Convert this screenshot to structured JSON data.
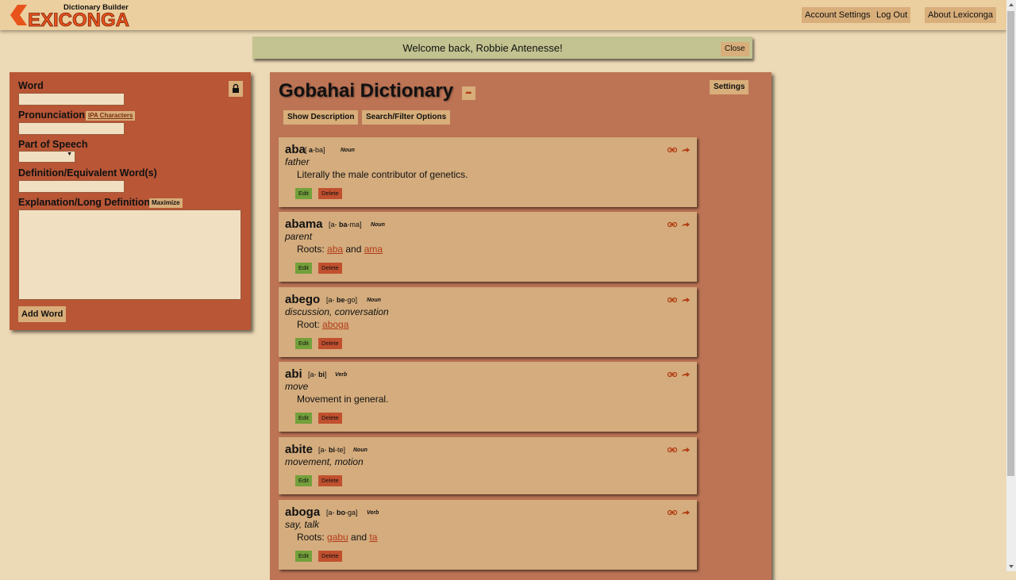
{
  "header": {
    "logo_tagline": "Dictionary Builder",
    "logo_text": "EXICONGA",
    "buttons": {
      "account_settings": "Account Settings",
      "log_out": "Log Out",
      "about": "About Lexiconga"
    }
  },
  "welcome": {
    "message": "Welcome back, Robbie Antenesse!",
    "close_label": "Close"
  },
  "word_form": {
    "word_label": "Word",
    "pronunciation_label": "Pronunciation",
    "ipa_label": "IPA Characters",
    "part_of_speech_label": "Part of Speech",
    "part_of_speech_value": "",
    "definition_label": "Definition/Equivalent Word(s)",
    "explanation_label": "Explanation/Long Definition",
    "maximize_label": "Maximize",
    "add_word_label": "Add Word"
  },
  "dictionary": {
    "title": "Gobahai Dictionary",
    "settings_label": "Settings",
    "show_description_label": "Show Description",
    "search_filter_label": "Search/Filter Options",
    "edit_label": "Edit",
    "delete_label": "Delete",
    "entries": [
      {
        "word": "aba",
        "pron_pre": "[ ",
        "pron_stress": "a",
        "pron_rest": "-ba]",
        "pos": "Noun",
        "definition": "father",
        "detail": "Literally the male contributor of genetics."
      },
      {
        "word": "abama",
        "pron_pre": "[a- ",
        "pron_stress": "ba",
        "pron_rest": "-ma]",
        "pos": "Noun",
        "definition": "parent",
        "detail_prefix": "Roots: ",
        "link1": "aba",
        "detail_mid": " and ",
        "link2": "ama"
      },
      {
        "word": "abego",
        "pron_pre": "[a- ",
        "pron_stress": "be",
        "pron_rest": "-go]",
        "pos": "Noun",
        "definition": "discussion, conversation",
        "detail_prefix": "Root: ",
        "link1": "aboga"
      },
      {
        "word": "abi",
        "pron_pre": "[a- ",
        "pron_stress": "bi",
        "pron_rest": "]",
        "pos": "Verb",
        "definition": "move",
        "detail": "Movement in general."
      },
      {
        "word": "abite",
        "pron_pre": "[a- ",
        "pron_stress": "bi",
        "pron_rest": "-te]",
        "pos": "Noun",
        "definition": "movement, motion"
      },
      {
        "word": "aboga",
        "pron_pre": "[a- ",
        "pron_stress": "bo",
        "pron_rest": "-ga]",
        "pos": "Verb",
        "definition": "say, talk",
        "detail_prefix": "Roots: ",
        "link1": "gabu",
        "detail_mid": " and ",
        "link2": "ta"
      }
    ]
  },
  "icons": {
    "lock": "lock-icon",
    "link": "link-icon",
    "share": "share-arrow-icon"
  },
  "colors": {
    "background": "#ecd9b5",
    "header": "#eccf9e",
    "button": "#d8ae7a",
    "form_panel": "#b85636",
    "dictionary_panel": "#bd7455",
    "entry": "#d4ac7d",
    "edit": "#73a03b",
    "delete": "#c1502e",
    "welcome": "#c3c391"
  }
}
